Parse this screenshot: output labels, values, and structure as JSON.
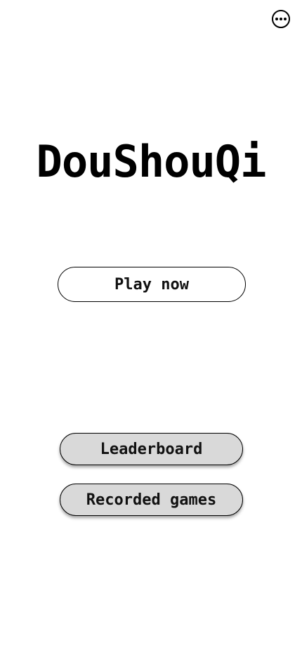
{
  "header": {
    "more_icon": "more-horizontal-circle-icon"
  },
  "main": {
    "title": "DouShouQi",
    "play_label": "Play now",
    "leaderboard_label": "Leaderboard",
    "recorded_games_label": "Recorded games"
  },
  "colors": {
    "background": "#ffffff",
    "text": "#000000",
    "secondary_button_bg": "#d9d9d9"
  }
}
